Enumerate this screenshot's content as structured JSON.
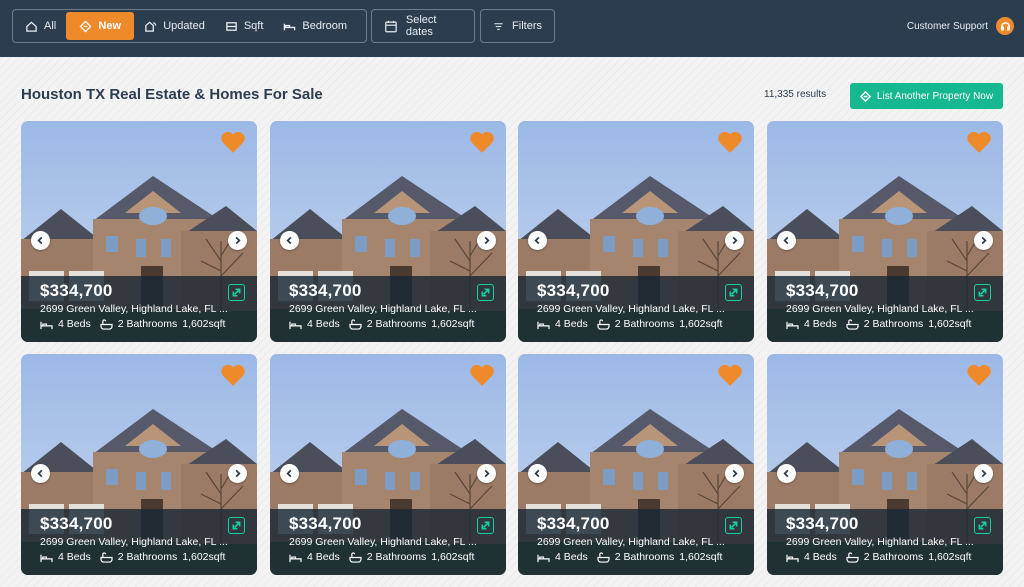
{
  "nav": {
    "segments": [
      {
        "label": "All",
        "icon": "home-icon",
        "active": false
      },
      {
        "label": "New",
        "icon": "diamond-icon",
        "active": true
      },
      {
        "label": "Updated",
        "icon": "refresh-house-icon",
        "active": false
      },
      {
        "label": "Sqft",
        "icon": "ruler-icon",
        "active": false
      },
      {
        "label": "Bedroom",
        "icon": "bed-icon",
        "active": false
      }
    ],
    "select_dates": "Select dates",
    "filters": "Filters",
    "support": "Customer Support"
  },
  "header": {
    "title": "Houston TX Real Estate & Homes For Sale",
    "results": "11,335 results",
    "cta": "List Another Property Now"
  },
  "colors": {
    "navbar": "#2c3d4f",
    "accent": "#ef8a2b",
    "cta": "#17b890"
  },
  "listings": [
    {
      "price": "$334,700",
      "address": "2699 Green Valley, Highland Lake, FL ...",
      "beds": "4 Beds",
      "baths": "2 Bathrooms",
      "sqft": "1,602sqft"
    },
    {
      "price": "$334,700",
      "address": "2699 Green Valley, Highland Lake, FL ...",
      "beds": "4 Beds",
      "baths": "2 Bathrooms",
      "sqft": "1,602sqft"
    },
    {
      "price": "$334,700",
      "address": "2699 Green Valley, Highland Lake, FL ...",
      "beds": "4 Beds",
      "baths": "2 Bathrooms",
      "sqft": "1,602sqft"
    },
    {
      "price": "$334,700",
      "address": "2699 Green Valley, Highland Lake, FL ...",
      "beds": "4 Beds",
      "baths": "2 Bathrooms",
      "sqft": "1,602sqft"
    },
    {
      "price": "$334,700",
      "address": "2699 Green Valley, Highland Lake, FL ...",
      "beds": "4 Beds",
      "baths": "2 Bathrooms",
      "sqft": "1,602sqft"
    },
    {
      "price": "$334,700",
      "address": "2699 Green Valley, Highland Lake, FL ...",
      "beds": "4 Beds",
      "baths": "2 Bathrooms",
      "sqft": "1,602sqft"
    },
    {
      "price": "$334,700",
      "address": "2699 Green Valley, Highland Lake, FL ...",
      "beds": "4 Beds",
      "baths": "2 Bathrooms",
      "sqft": "1,602sqft"
    },
    {
      "price": "$334,700",
      "address": "2699 Green Valley, Highland Lake, FL ...",
      "beds": "4 Beds",
      "baths": "2 Bathrooms",
      "sqft": "1,602sqft"
    }
  ]
}
